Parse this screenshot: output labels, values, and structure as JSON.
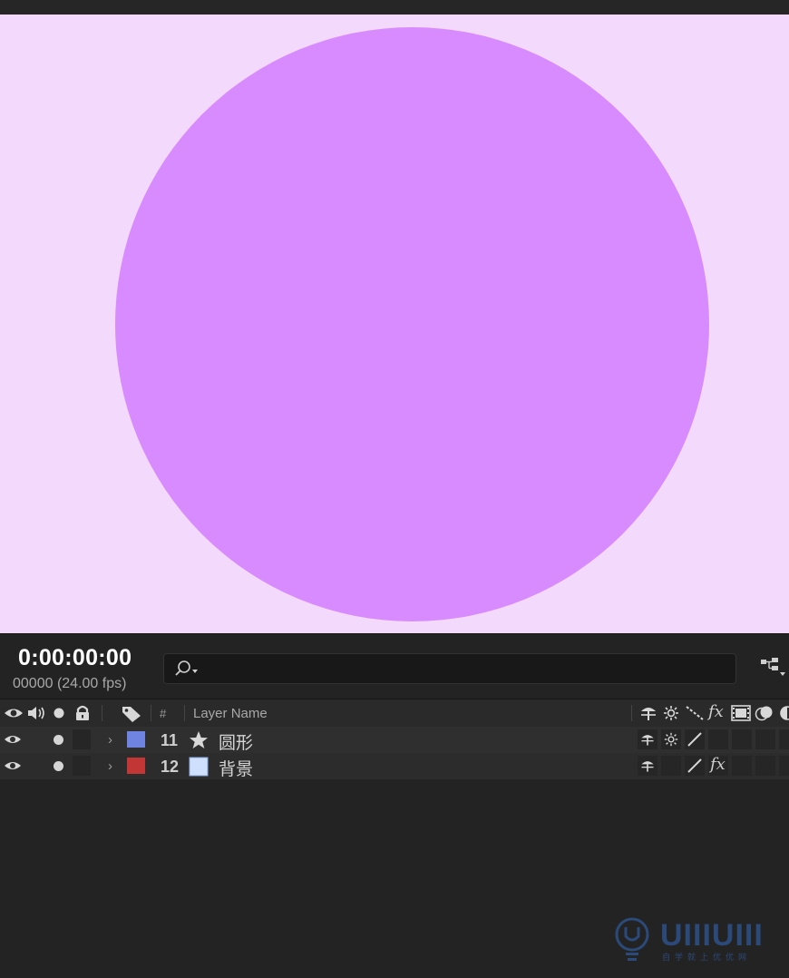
{
  "viewer": {
    "background_color": "#f3dafc",
    "shape_color": "#d88bff"
  },
  "timeline": {
    "timecode": "0:00:00:00",
    "frame_info": "00000 (24.00 fps)",
    "search_value": ""
  },
  "columns": {
    "hash": "#",
    "layer_name": "Layer Name"
  },
  "layers": [
    {
      "number": "11",
      "name": "圆形",
      "label_color": "#6e84e0",
      "type_icon": "star-icon"
    },
    {
      "number": "12",
      "name": "背景",
      "label_color": "#c23636",
      "type_icon": "solid-icon"
    }
  ],
  "watermark": {
    "brand": "UIIIUIII",
    "tagline": "自学就上优优网"
  }
}
